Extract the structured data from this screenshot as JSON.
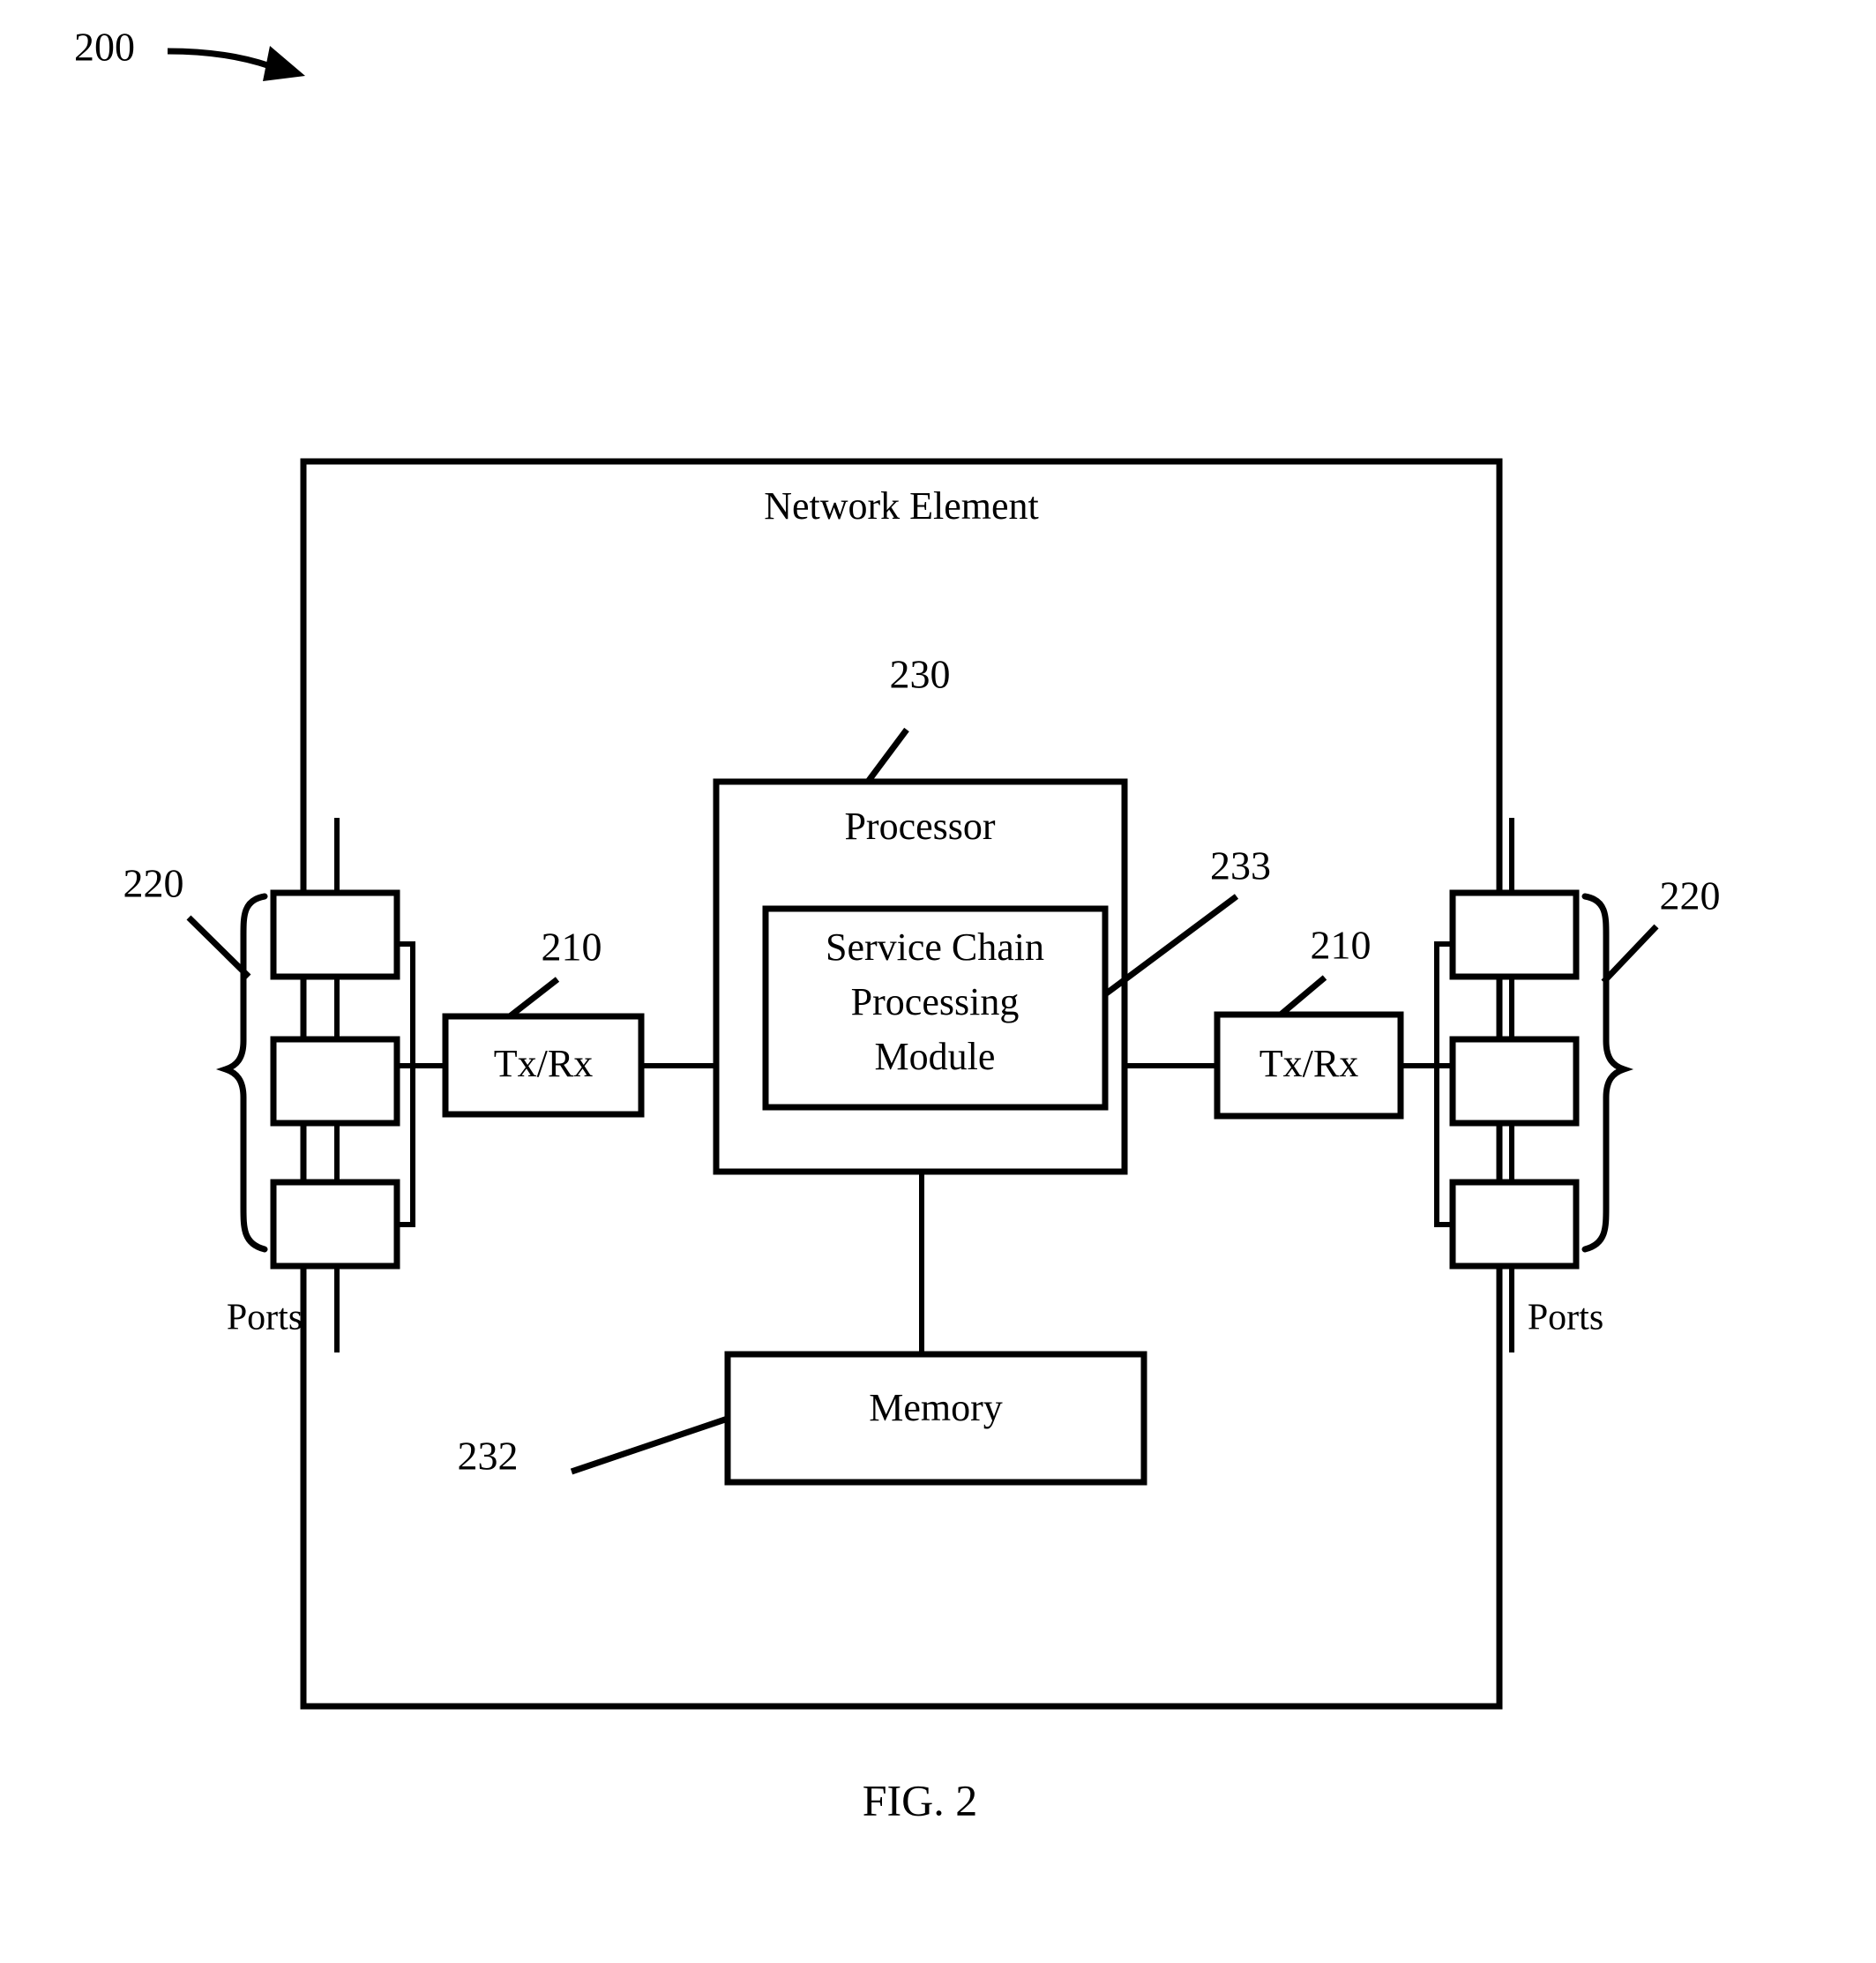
{
  "figure": {
    "figure_number_label": "200",
    "caption": "FIG. 2",
    "container_title": "Network Element"
  },
  "blocks": {
    "processor": {
      "label": "Processor",
      "reference_numeral": "230"
    },
    "service_chain_module": {
      "label_line1": "Service Chain",
      "label_line2": "Processing",
      "label_line3": "Module",
      "reference_numeral": "233"
    },
    "memory": {
      "label": "Memory",
      "reference_numeral": "232"
    },
    "transceiver_left": {
      "label": "Tx/Rx",
      "reference_numeral": "210"
    },
    "transceiver_right": {
      "label": "Tx/Rx",
      "reference_numeral": "210"
    },
    "ports_left": {
      "label": "Ports",
      "reference_numeral": "220",
      "port_count": 3
    },
    "ports_right": {
      "label": "Ports",
      "reference_numeral": "220",
      "port_count": 3
    }
  },
  "colors": {
    "stroke": "#000000",
    "background": "#ffffff"
  }
}
